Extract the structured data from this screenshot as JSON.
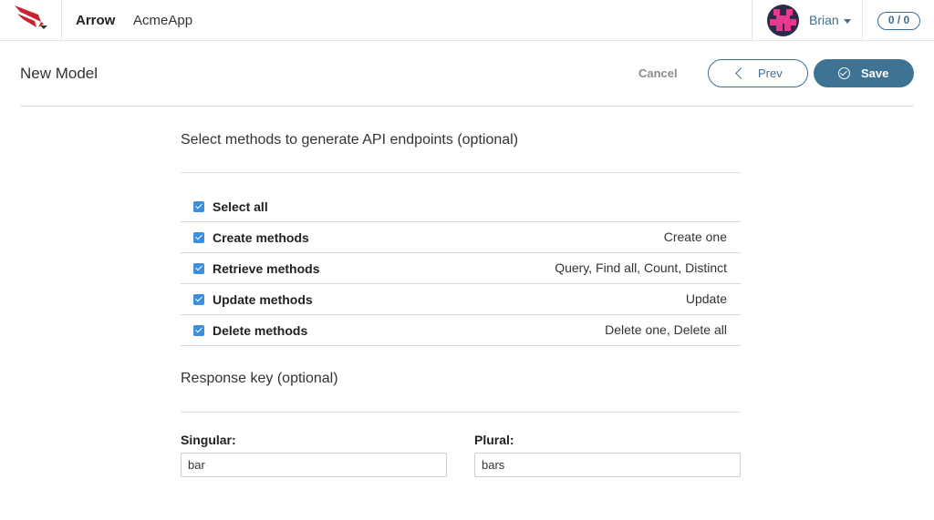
{
  "topbar": {
    "brand": "Arrow",
    "app_name": "AcmeApp",
    "user_name": "Brian",
    "counter": "0 / 0"
  },
  "header": {
    "title": "New Model",
    "cancel_label": "Cancel",
    "prev_label": "Prev",
    "save_label": "Save"
  },
  "methods_section": {
    "title": "Select methods to generate API endpoints (optional)",
    "rows": [
      {
        "label": "Select all",
        "description": "",
        "checked": true
      },
      {
        "label": "Create methods",
        "description": "Create one",
        "checked": true
      },
      {
        "label": "Retrieve methods",
        "description": "Query, Find all, Count, Distinct",
        "checked": true
      },
      {
        "label": "Update methods",
        "description": "Update",
        "checked": true
      },
      {
        "label": "Delete methods",
        "description": "Delete one, Delete all",
        "checked": true
      }
    ]
  },
  "response_section": {
    "title": "Response key (optional)",
    "singular_label": "Singular:",
    "singular_value": "bar",
    "plural_label": "Plural:",
    "plural_value": "bars"
  },
  "icons": {
    "logo": "arrow-logo-icon",
    "prev": "chevron-left-icon",
    "save": "check-circle-icon",
    "checkbox": "checkbox-checked-icon"
  },
  "colors": {
    "accent": "#3d6f93",
    "save_bg": "#3f7394",
    "checkbox": "#3b8fdc",
    "logo": "#c8242f"
  }
}
